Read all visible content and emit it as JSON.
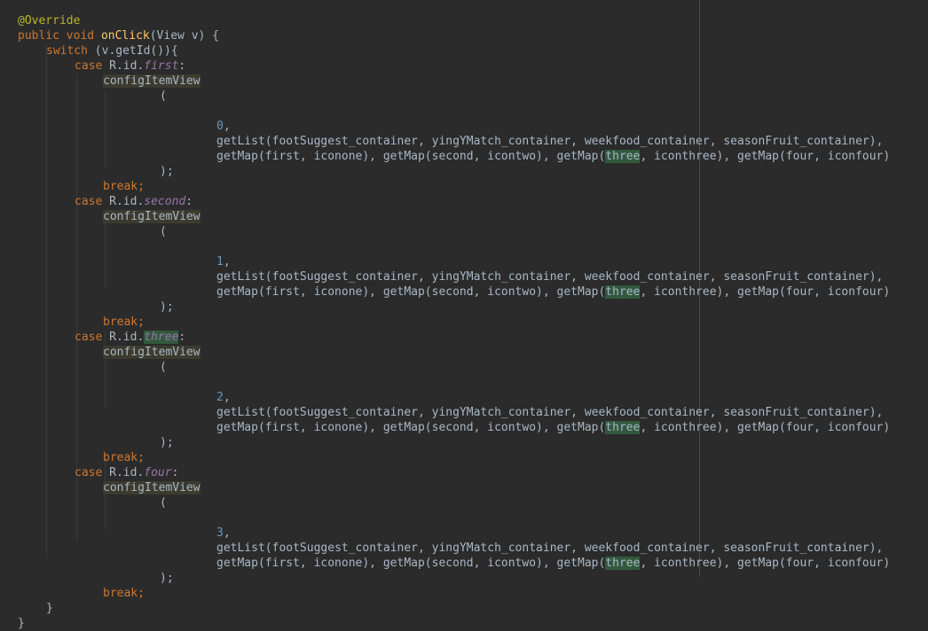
{
  "editor": {
    "lines": {
      "annotation": "@Override",
      "sig_public": "public",
      "sig_void": "void",
      "sig_name": "onClick",
      "sig_rest": "(View v) {",
      "sw_kw": "switch",
      "sw_rest": " (v.getId()){",
      "case_kw": "case",
      "rid": "R.id.",
      "colon": ":",
      "call": "configItemView",
      "open_paren": "(",
      "comma": ",",
      "list_get": "getList",
      "list_args": "(footSuggest_container, yingYMatch_container, weekfood_container, seasonFruit_container),",
      "map_line_a": "getMap(first, iconone), getMap(second, icontwo), getMap(",
      "three": "three",
      "map_line_b": ", iconthree), getMap(four, iconfour)",
      "close": ");",
      "break_kw": "break",
      "semi": ";",
      "brace_inner": "}",
      "brace_outer": "}"
    },
    "cases": [
      {
        "field": "first",
        "index": "0"
      },
      {
        "field": "second",
        "index": "1"
      },
      {
        "field": "three",
        "index": "2"
      },
      {
        "field": "four",
        "index": "3"
      }
    ]
  },
  "colors": {
    "background": "#2b2b2b",
    "keyword": "#cc7832",
    "method": "#ffc66d",
    "field": "#9876aa",
    "number": "#6897bb",
    "annotation": "#bbb529",
    "text": "#a9b7c6"
  }
}
